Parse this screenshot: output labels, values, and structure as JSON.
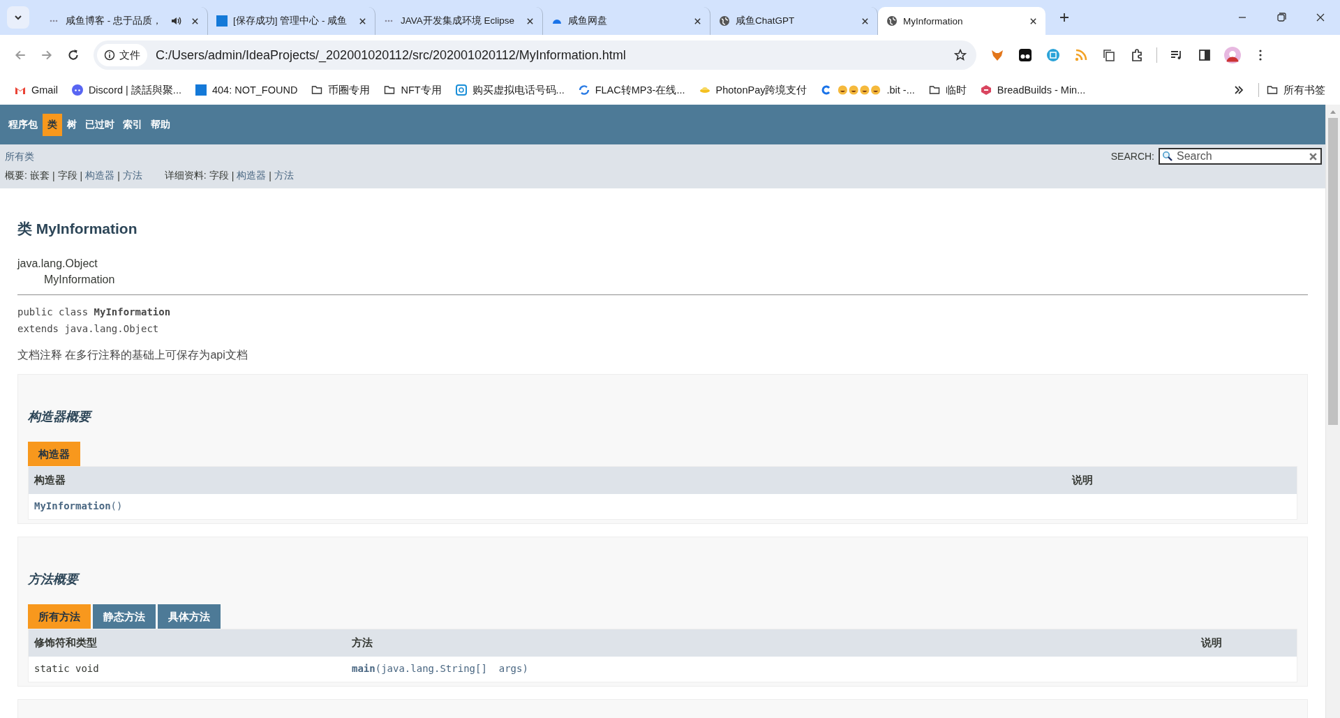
{
  "browser": {
    "tabs": [
      {
        "kind": "dots",
        "title": "咸鱼博客 - 忠于品质，",
        "audio": true,
        "selected": false
      },
      {
        "kind": "em",
        "title": "[保存成功] 管理中心 - 咸鱼",
        "audio": false,
        "selected": false
      },
      {
        "kind": "dots",
        "title": "JAVA开发集成环境 Eclipse",
        "audio": false,
        "selected": false
      },
      {
        "kind": "cloud",
        "title": "咸鱼网盘",
        "audio": false,
        "selected": false
      },
      {
        "kind": "globe",
        "title": "咸鱼ChatGPT",
        "audio": false,
        "selected": false
      },
      {
        "kind": "globe",
        "title": "MyInformation",
        "audio": false,
        "selected": true
      }
    ],
    "address": {
      "security_label": "文件",
      "url": "C:/Users/admin/IdeaProjects/_202001020112/src/202001020112/MyInformation.html"
    },
    "bookmarks": [
      {
        "kind": "gmail",
        "label": "Gmail"
      },
      {
        "kind": "discord",
        "label": "Discord | 談話與聚..."
      },
      {
        "kind": "em",
        "label": "404: NOT_FOUND"
      },
      {
        "kind": "folder",
        "label": "币圈专用"
      },
      {
        "kind": "folder",
        "label": "NFT专用"
      },
      {
        "kind": "app",
        "label": "购买虚拟电话号码..."
      },
      {
        "kind": "swirl",
        "label": "FLAC转MP3-在线..."
      },
      {
        "kind": "saucer",
        "label": "PhotonPay跨境支付"
      },
      {
        "kind": "emoji",
        "label": ".bit -..."
      },
      {
        "kind": "folder",
        "label": "临时"
      },
      {
        "kind": "bread",
        "label": "BreadBuilds - Min..."
      }
    ],
    "all_bookmarks": "所有书签"
  },
  "doc": {
    "nav": [
      {
        "label": "程序包",
        "selected": false
      },
      {
        "label": "类",
        "selected": true
      },
      {
        "label": "树",
        "selected": false
      },
      {
        "label": "已过时",
        "selected": false
      },
      {
        "label": "索引",
        "selected": false
      },
      {
        "label": "帮助",
        "selected": false
      }
    ],
    "all_classes": "所有类",
    "separator": "|",
    "summary": {
      "label": "概要:",
      "items": [
        {
          "label": "嵌套",
          "link": false
        },
        {
          "label": "字段",
          "link": false
        },
        {
          "label": "构造器",
          "link": true
        },
        {
          "label": "方法",
          "link": true
        }
      ]
    },
    "detail": {
      "label": "详细资料:",
      "items": [
        {
          "label": "字段",
          "link": false
        },
        {
          "label": "构造器",
          "link": true
        },
        {
          "label": "方法",
          "link": true
        }
      ]
    },
    "search": {
      "label": "SEARCH:",
      "placeholder": "Search"
    },
    "title": "类 MyInformation",
    "inheritance": [
      "java.lang.Object",
      "MyInformation"
    ],
    "signature": [
      "public class **MyInformation**",
      "extends java.lang.Object"
    ],
    "description": "文档注释 在多行注释的基础上可保存为api文档",
    "sections": [
      {
        "heading": "构造器概要",
        "tabs": [
          {
            "label": "构造器",
            "selected": true
          }
        ],
        "columns": [
          "构造器",
          "说明"
        ],
        "rows": [
          [
            "**MyInformation**()"
          ]
        ]
      },
      {
        "heading": "方法概要",
        "tabs": [
          {
            "label": "所有方法",
            "selected": true
          },
          {
            "label": "静态方法",
            "selected": false
          },
          {
            "label": "具体方法",
            "selected": false
          }
        ],
        "columns": [
          "修饰符和类型",
          "方法",
          "说明"
        ],
        "rows": [
          [
            "static void",
            "**main**(java.lang.String[]  args)"
          ]
        ]
      }
    ]
  }
}
